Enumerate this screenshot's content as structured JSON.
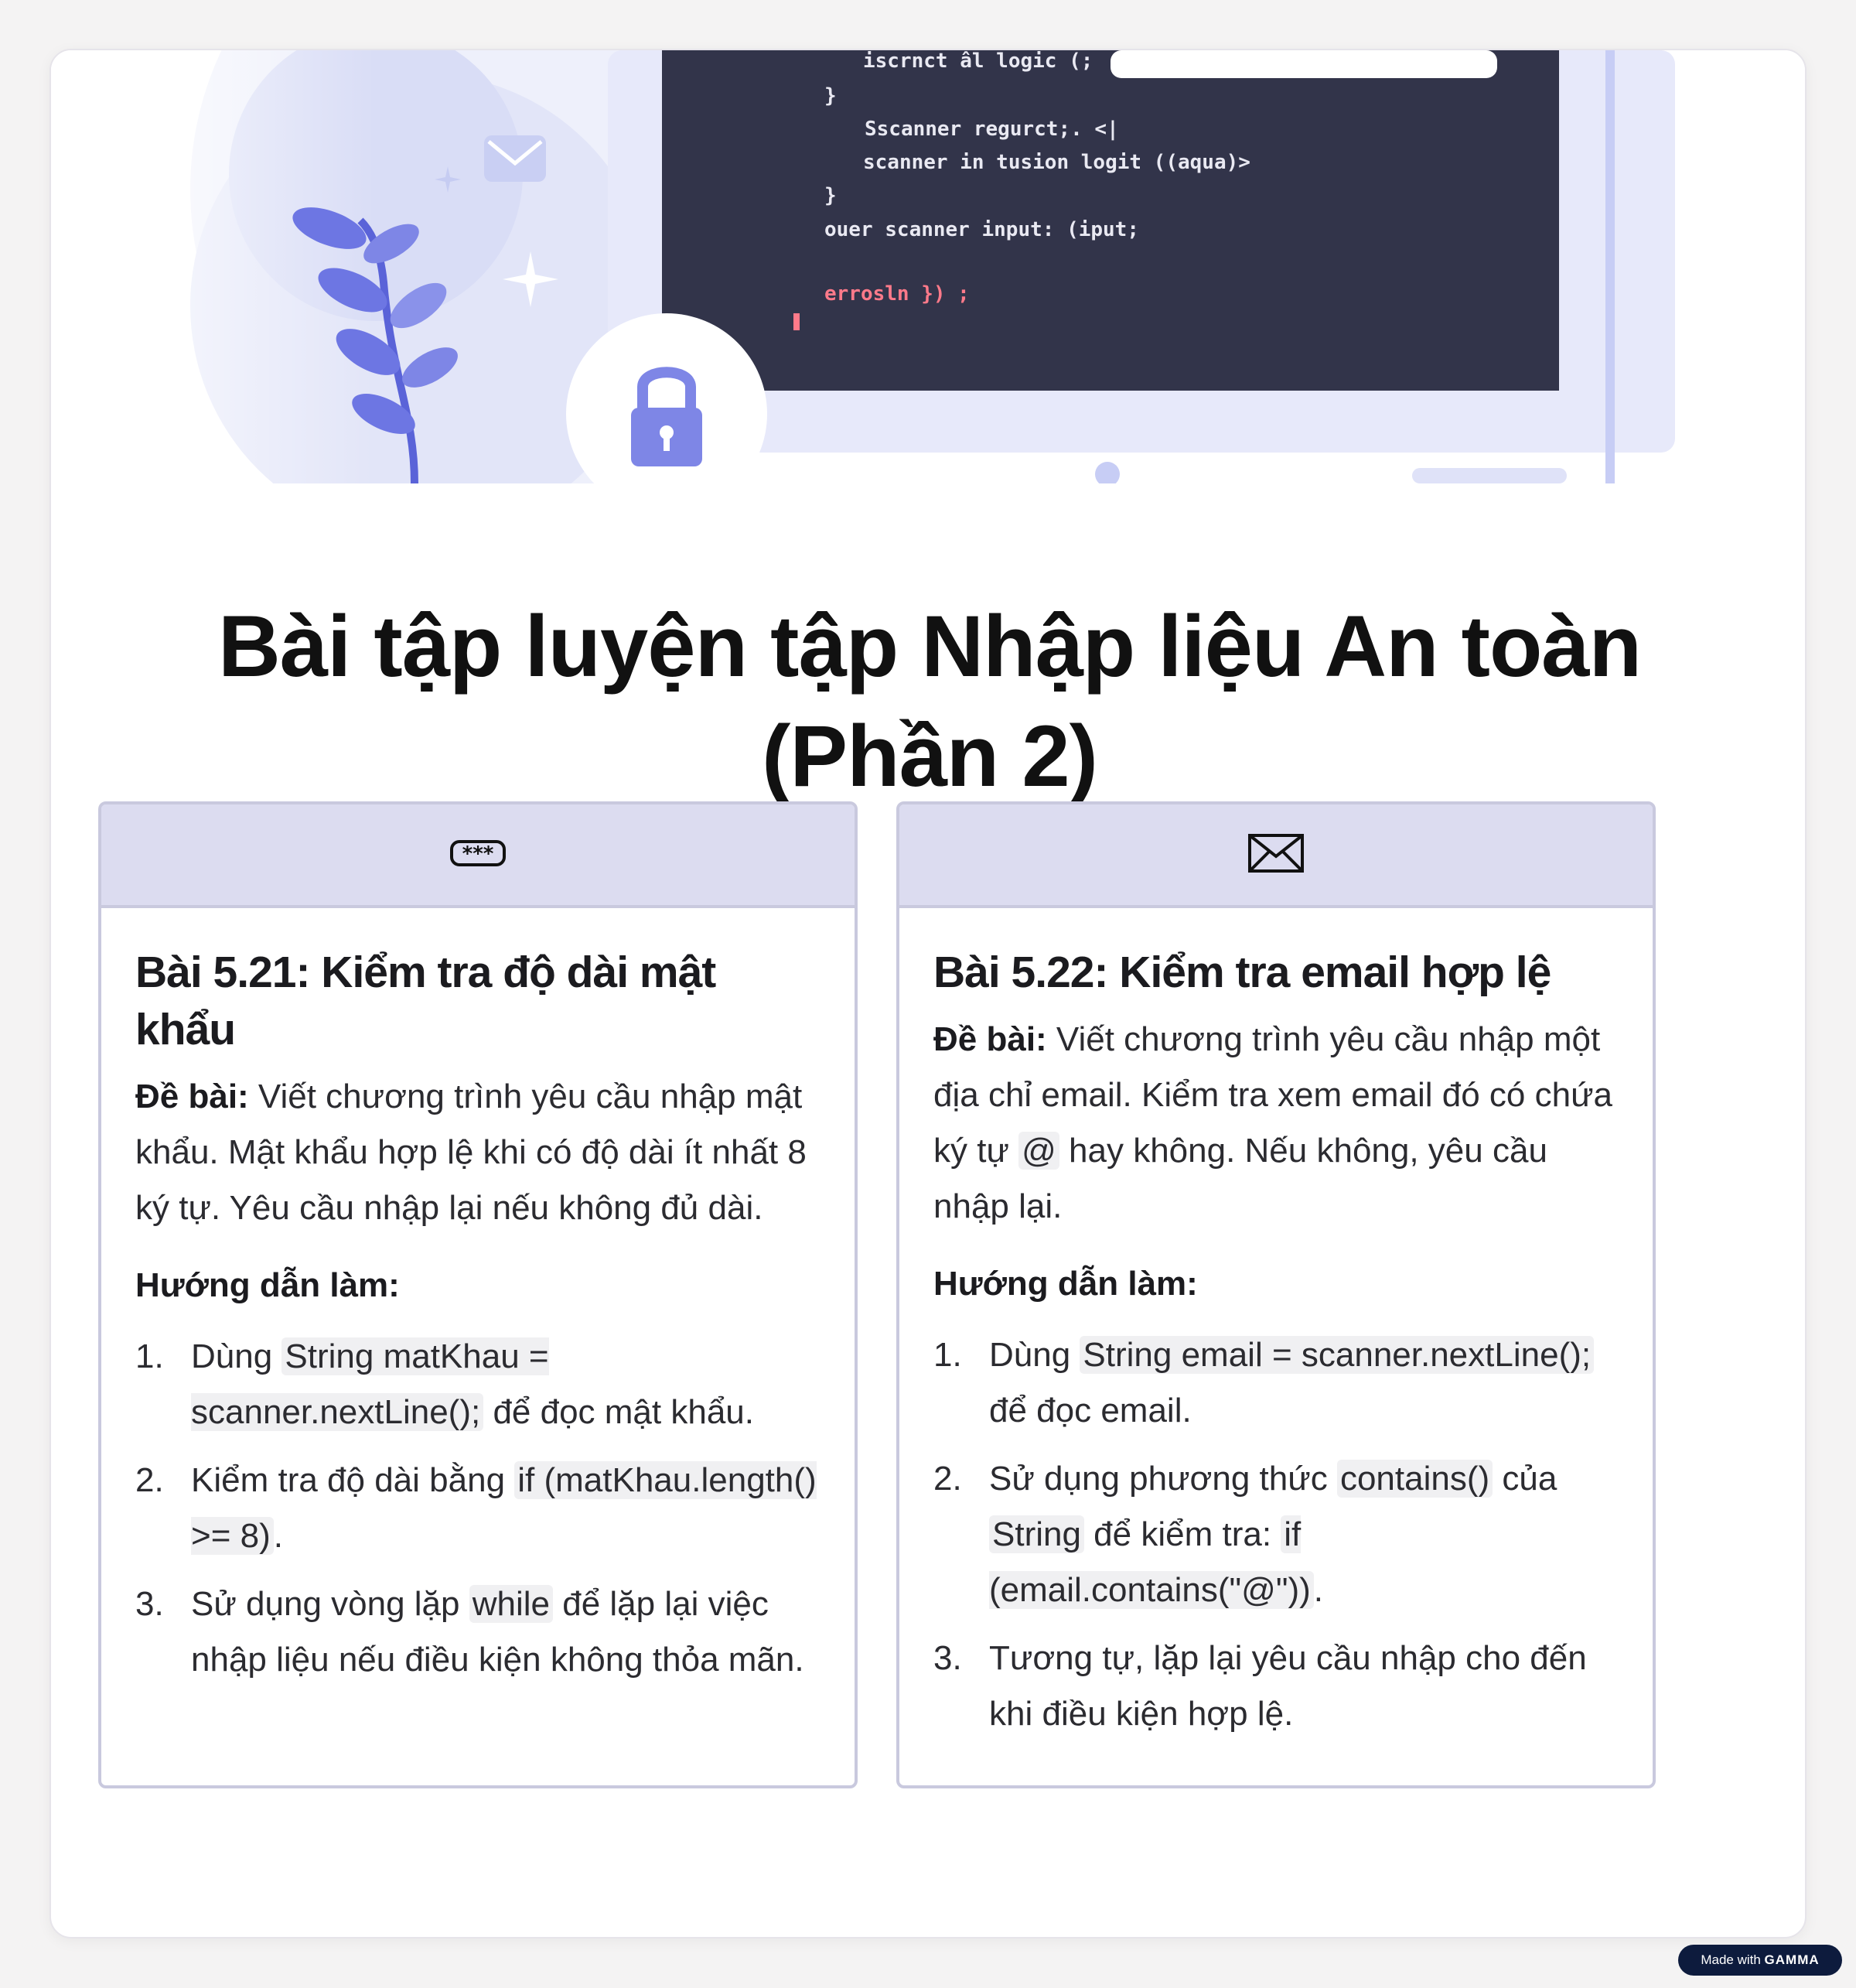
{
  "title": {
    "line1": "Bài tập luyện tập Nhập liệu An toàn",
    "line2": "(Phần 2)"
  },
  "hero": {
    "code_lines": [
      "iscrnct âl logic (;",
      "}",
      "Sscanner regurct;.  <|",
      "scanner in tusion logit ((aqua)>",
      "}",
      "ouer scanner input: (iput;",
      "errosln }) ;"
    ]
  },
  "left_card": {
    "icon": "password-icon",
    "heading": "Bài 5.21: Kiểm tra độ dài mật khẩu",
    "prompt_label": "Đề bài:",
    "prompt_text": " Viết chương trình yêu cầu nhập mật khẩu. Mật khẩu hợp lệ khi có độ dài ít nhất 8 ký tự. Yêu cầu nhập lại nếu không đủ dài.",
    "guide_label": "Hướng dẫn làm:",
    "steps": [
      {
        "num": "1.",
        "pre": "Dùng ",
        "code": "String matKhau = scanner.nextLine();",
        "post": " để đọc mật khẩu."
      },
      {
        "num": "2.",
        "pre": "Kiểm tra độ dài bằng ",
        "code": "if (matKhau.length() >= 8)",
        "post": "."
      },
      {
        "num": "3.",
        "pre": "Sử dụng vòng lặp ",
        "code": "while",
        "post": " để lặp lại việc nhập liệu nếu điều kiện không thỏa mãn."
      }
    ]
  },
  "right_card": {
    "icon": "envelope-icon",
    "heading": "Bài 5.22: Kiểm tra email hợp lệ",
    "prompt_label": "Đề bài:",
    "prompt_pre": " Viết chương trình yêu cầu nhập một địa chỉ email. Kiểm tra xem email đó có chứa ký tự ",
    "prompt_code": "@",
    "prompt_post": " hay không. Nếu không, yêu cầu nhập lại.",
    "guide_label": "Hướng dẫn làm:",
    "steps": [
      {
        "num": "1.",
        "pre": "Dùng ",
        "code": "String email = scanner.nextLine();",
        "post": " để đọc email."
      },
      {
        "num": "2.",
        "pre": "Sử dụng phương thức ",
        "code": "contains()",
        "mid": " của ",
        "code2": "String",
        "mid2": " để kiểm tra: ",
        "code3": "if (email.contains(\"@\"))",
        "post": "."
      },
      {
        "num": "3.",
        "pre": "Tương tự, lặp lại yêu cầu nhập cho đến khi điều kiện hợp lệ.",
        "code": "",
        "post": ""
      }
    ]
  },
  "footer": {
    "badge_prefix": "Made with",
    "badge_brand": "GAMMA"
  },
  "colors": {
    "accent": "#dcdcf0",
    "border": "#c9c9de",
    "code_bg": "#32344a",
    "illustration": "#7e86e6"
  }
}
